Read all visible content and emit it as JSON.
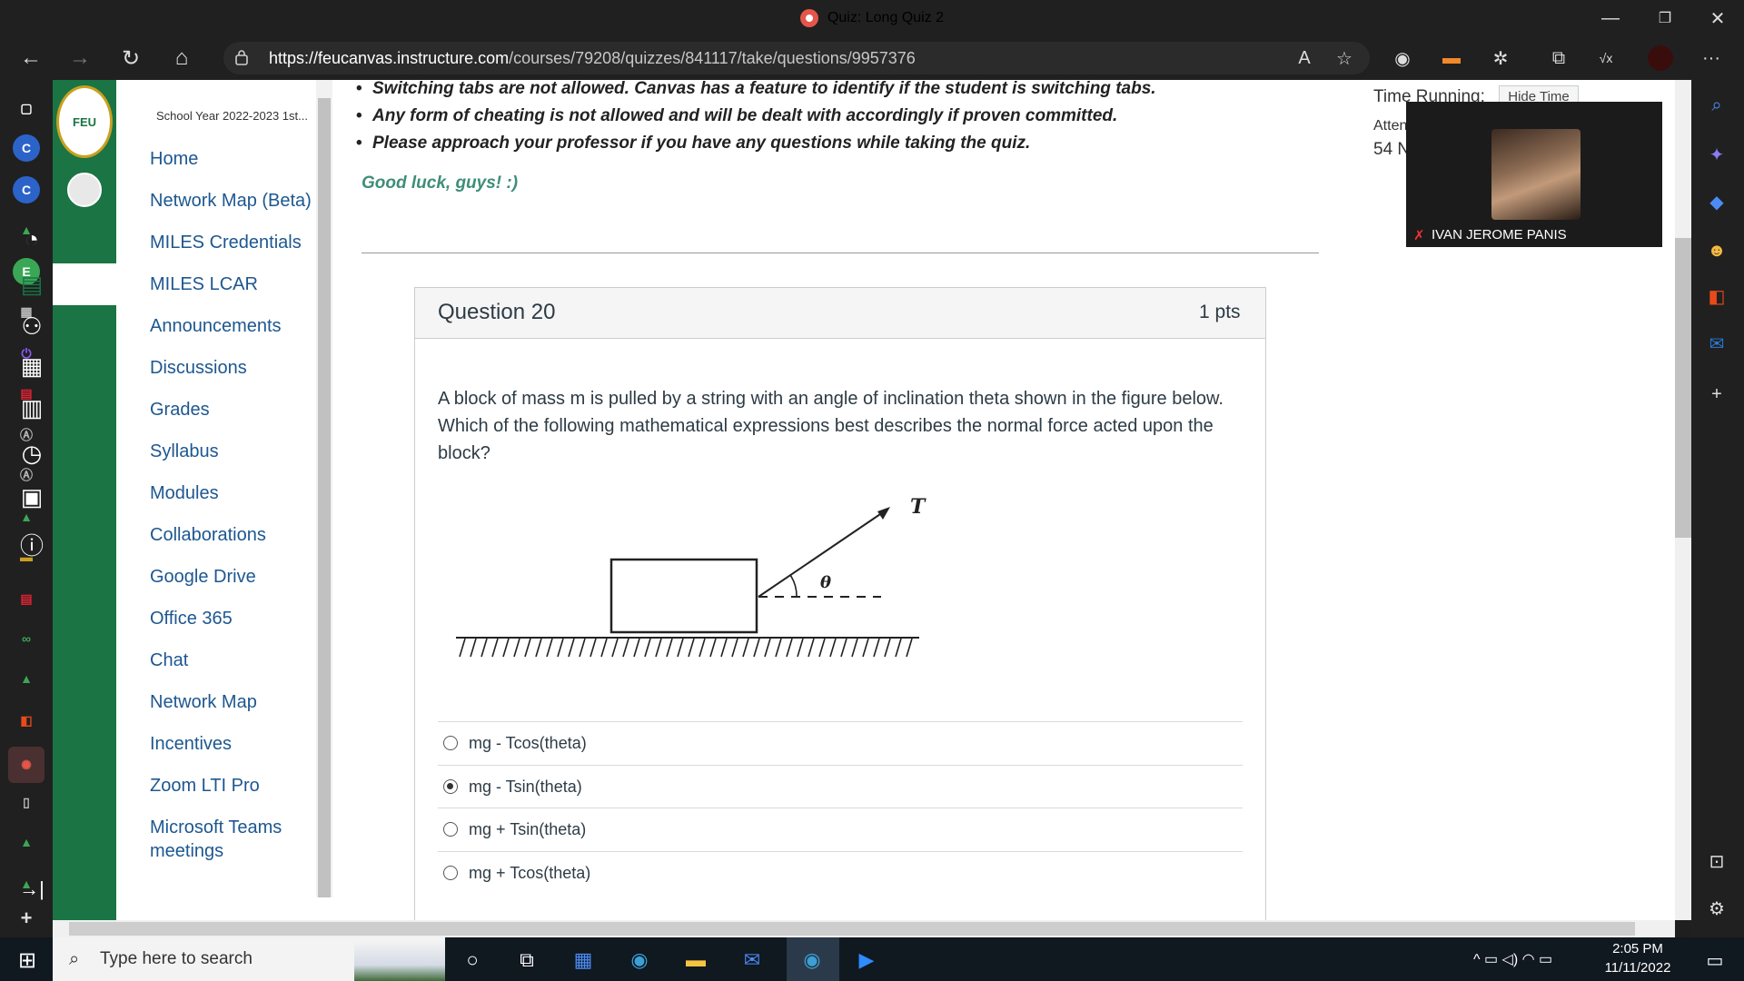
{
  "window": {
    "title": "Quiz: Long Quiz 2",
    "minimize": "—",
    "restore": "❐",
    "close": "✕"
  },
  "browser": {
    "back": "←",
    "forward": "→",
    "reload": "↻",
    "home": "⌂",
    "url_host": "https://feucanvas.instructure.com",
    "url_path": "/courses/79208/quizzes/841117/take/questions/9957376",
    "read_aloud": "A",
    "favorite": "☆",
    "more": "···"
  },
  "global_nav": {
    "logo_text": "FEU",
    "collapse": "→|"
  },
  "course_nav": {
    "term": "School Year 2022-2023 1st...",
    "items": [
      "Home",
      "Network Map (Beta)",
      "MILES Credentials",
      "MILES LCAR",
      "Announcements",
      "Discussions",
      "Grades",
      "Syllabus",
      "Modules",
      "Collaborations",
      "Google Drive",
      "Office 365",
      "Chat",
      "Network Map",
      "Incentives",
      "Zoom LTI Pro",
      "Microsoft Teams",
      "meetings"
    ]
  },
  "instructions": {
    "bullets": [
      "Switching tabs are not allowed. Canvas has a feature to identify if the student is switching tabs.",
      "Any form of cheating is not allowed and will be dealt with accordingly if proven committed.",
      "Please approach your professor if you have any questions while taking the quiz."
    ],
    "good_luck": "Good luck, guys! :)"
  },
  "question": {
    "title": "Question 20",
    "points": "1 pts",
    "text": "A block of mass m is pulled by a string with an angle of inclination theta shown in the figure below. Which of the following mathematical expressions best describes the normal force acted upon the block?",
    "figure_labels": {
      "tension": "T",
      "angle": "θ"
    },
    "answers": [
      {
        "label": "mg - Tcos(theta)",
        "selected": false
      },
      {
        "label": "mg - Tsin(theta)",
        "selected": true
      },
      {
        "label": "mg + Tsin(theta)",
        "selected": false
      },
      {
        "label": "mg + Tcos(theta)",
        "selected": false
      }
    ]
  },
  "timer": {
    "label": "Time Running:",
    "hide_button": "Hide Time",
    "attempt_label": "Atten",
    "value": "54 N"
  },
  "zoom": {
    "participant": "IVAN JEROME PANIS"
  },
  "taskbar": {
    "search_placeholder": "Type here to search",
    "time": "2:05 PM",
    "date": "11/11/2022"
  },
  "colors": {
    "canvas_green": "#1a7444",
    "link_blue": "#1d5790",
    "good_luck_green": "#3e8e78"
  }
}
